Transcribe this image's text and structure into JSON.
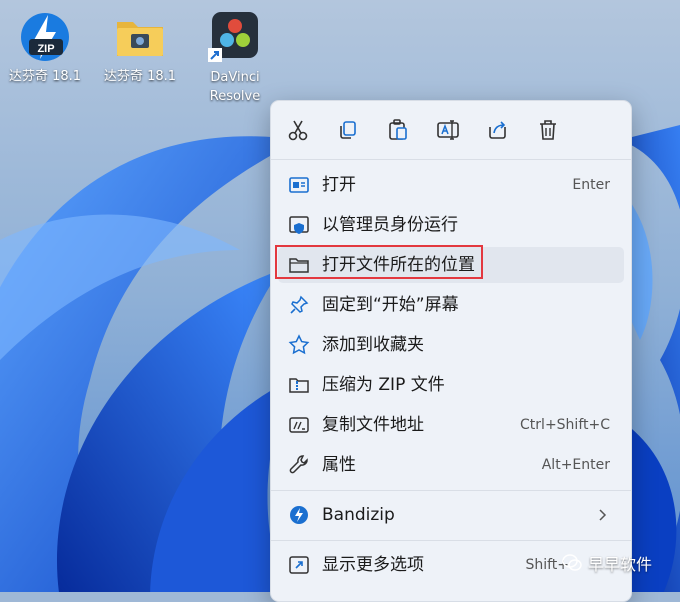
{
  "desktop": {
    "icons": [
      {
        "label": "达芬奇 18.1",
        "icon": "zip-archive-icon"
      },
      {
        "label": "达芬奇 18.1",
        "icon": "folder-icon"
      },
      {
        "label": "DaVinci Resolve",
        "icon": "davinci-resolve-icon"
      }
    ]
  },
  "context_menu": {
    "toolbar": [
      "cut-icon",
      "copy-icon",
      "paste-icon",
      "rename-icon",
      "share-icon",
      "delete-icon"
    ],
    "items": [
      {
        "label": "打开",
        "shortcut": "Enter",
        "icon": "open-window-icon"
      },
      {
        "label": "以管理员身份运行",
        "shortcut": "",
        "icon": "admin-shield-icon"
      },
      {
        "label": "打开文件所在的位置",
        "shortcut": "",
        "icon": "folder-outline-icon"
      },
      {
        "label": "固定到“开始”屏幕",
        "shortcut": "",
        "icon": "pin-icon"
      },
      {
        "label": "添加到收藏夹",
        "shortcut": "",
        "icon": "star-icon"
      },
      {
        "label": "压缩为 ZIP 文件",
        "shortcut": "",
        "icon": "zip-folder-icon"
      },
      {
        "label": "复制文件地址",
        "shortcut": "Ctrl+Shift+C",
        "icon": "copy-path-icon"
      },
      {
        "label": "属性",
        "shortcut": "Alt+Enter",
        "icon": "wrench-icon"
      },
      {
        "label": "Bandizip",
        "shortcut": "",
        "icon": "bandizip-icon"
      },
      {
        "label": "显示更多选项",
        "shortcut": "Shift+",
        "icon": "more-options-icon"
      }
    ]
  },
  "watermark": {
    "text": "早早软件"
  },
  "colors": {
    "highlight": "#e3383f",
    "accent": "#0067c0",
    "menu_bg": "#eef2f8"
  }
}
